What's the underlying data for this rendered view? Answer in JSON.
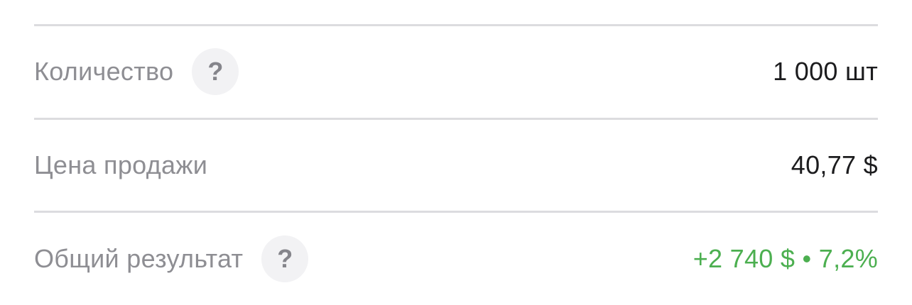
{
  "rows": [
    {
      "label": "Количество",
      "help_icon": "question-icon",
      "help_glyph": "?",
      "value": "1 000 шт"
    },
    {
      "label": "Цена продажи",
      "value": "40,77 $"
    },
    {
      "label": "Общий результат",
      "help_icon": "question-icon",
      "help_glyph": "?",
      "value": "+2 740 $ • 7,2%",
      "value_color": "#4caf50"
    }
  ],
  "colors": {
    "label": "#8e8e93",
    "value": "#1c1c1e",
    "positive": "#4caf50",
    "divider": "#dcdcdf",
    "help_bg": "#f2f2f4"
  }
}
